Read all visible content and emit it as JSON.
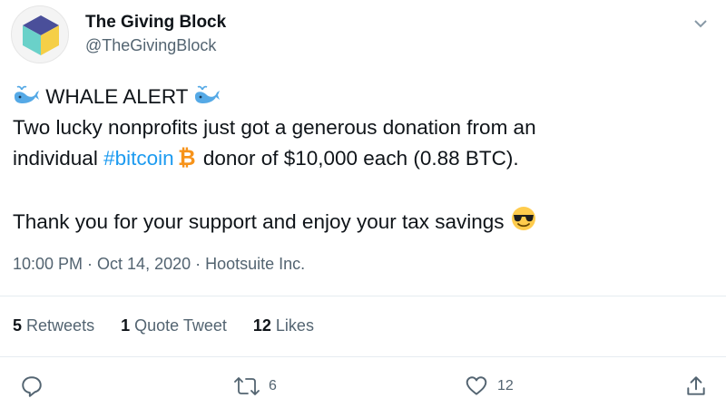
{
  "account": {
    "name": "The Giving Block",
    "handle": "@TheGivingBlock"
  },
  "tweet": {
    "line1": "WHALE ALERT",
    "line2": "Two lucky nonprofits just got a generous donation from an",
    "line3_before": "individual ",
    "line3_hashtag": "#bitcoin",
    "line3_after": " donor of $10,000 each (0.88 BTC).",
    "line4": "Thank you for your support and enjoy your tax savings"
  },
  "meta": {
    "time": "10:00 PM",
    "date": "Oct 14, 2020",
    "source": "Hootsuite Inc.",
    "separator": " · "
  },
  "stats": {
    "retweets_count": "5",
    "retweets_label": "Retweets",
    "quotes_count": "1",
    "quotes_label": "Quote Tweet",
    "likes_count": "12",
    "likes_label": "Likes"
  },
  "actions": {
    "retweet_count": "6",
    "like_count": "12"
  },
  "colors": {
    "link": "#1d9bf0",
    "secondary_text": "#536471",
    "bitcoin": "#f7931a",
    "whale": "#55a9e6"
  },
  "icons": [
    "logo-cube-icon",
    "chevron-down-icon",
    "whale-icon",
    "bitcoin-icon",
    "sunglasses-emoji-icon",
    "reply-icon",
    "retweet-icon",
    "like-icon",
    "share-icon"
  ]
}
